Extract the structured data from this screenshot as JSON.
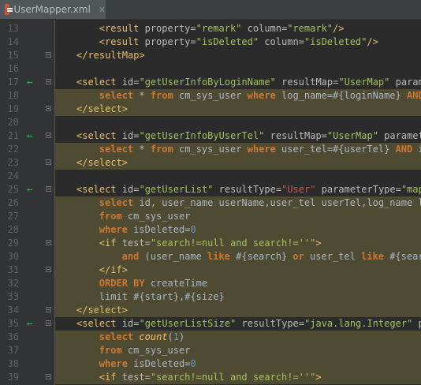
{
  "tab": {
    "filename": "UserMapper.xml",
    "close_glyph": "✕",
    "icon": "xml-file-icon"
  },
  "colors": {
    "background": "#2B2B2B",
    "gutter": "#313335",
    "highlight": "#4F4B32",
    "tag": "#E8BF6A",
    "string": "#A5C25C",
    "keyword": "#CC7832",
    "arrow": "#3DB05B"
  },
  "lines": [
    {
      "num": "13",
      "indent": 4,
      "hl": false,
      "mark": false,
      "fold": false,
      "segs": [
        [
          "tag",
          "<result "
        ],
        [
          "attr",
          "property="
        ],
        [
          "val",
          "\"remark\""
        ],
        [
          "attr",
          " column="
        ],
        [
          "val",
          "\"remark\""
        ],
        [
          "tag",
          "/>"
        ]
      ]
    },
    {
      "num": "14",
      "indent": 4,
      "hl": false,
      "mark": false,
      "fold": false,
      "segs": [
        [
          "tag",
          "<result "
        ],
        [
          "attr",
          "property="
        ],
        [
          "val",
          "\"isDeleted\""
        ],
        [
          "attr",
          " column="
        ],
        [
          "val",
          "\"isDeleted\""
        ],
        [
          "tag",
          "/>"
        ]
      ]
    },
    {
      "num": "15",
      "indent": 0,
      "hl": false,
      "mark": false,
      "fold": true,
      "segs": [
        [
          "tag",
          "</resultMap>"
        ]
      ]
    },
    {
      "num": "16",
      "indent": 0,
      "hl": false,
      "mark": false,
      "fold": false,
      "segs": []
    },
    {
      "num": "17",
      "indent": 0,
      "hl": false,
      "mark": true,
      "fold": true,
      "segs": [
        [
          "tag",
          "<select "
        ],
        [
          "attr",
          "id="
        ],
        [
          "val",
          "\"getUserInfoByLoginName\""
        ],
        [
          "attr",
          " resultMap="
        ],
        [
          "val",
          "\"UserMap\""
        ],
        [
          "attr",
          " paramet"
        ]
      ]
    },
    {
      "num": "18",
      "indent": 4,
      "hl": true,
      "mark": false,
      "fold": false,
      "segs": [
        [
          "kw",
          "select"
        ],
        [
          "txt",
          " * "
        ],
        [
          "kw",
          "from"
        ],
        [
          "txt",
          " cm_sys_user "
        ],
        [
          "kw",
          "where"
        ],
        [
          "txt",
          " log_name=#{loginName} "
        ],
        [
          "kw",
          "AND"
        ],
        [
          "txt",
          " i"
        ]
      ]
    },
    {
      "num": "19",
      "indent": 0,
      "hl": true,
      "mark": false,
      "fold": true,
      "segs": [
        [
          "tag",
          "</select>"
        ]
      ]
    },
    {
      "num": "20",
      "indent": 0,
      "hl": false,
      "mark": false,
      "fold": false,
      "segs": []
    },
    {
      "num": "21",
      "indent": 0,
      "hl": false,
      "mark": true,
      "fold": true,
      "segs": [
        [
          "tag",
          "<select "
        ],
        [
          "attr",
          "id="
        ],
        [
          "val",
          "\"getUserInfoByUserTel\""
        ],
        [
          "attr",
          " resultMap="
        ],
        [
          "val",
          "\"UserMap\""
        ],
        [
          "attr",
          " parameter"
        ]
      ]
    },
    {
      "num": "22",
      "indent": 4,
      "hl": true,
      "mark": false,
      "fold": false,
      "segs": [
        [
          "kw",
          "select"
        ],
        [
          "txt",
          " * "
        ],
        [
          "kw",
          "from"
        ],
        [
          "txt",
          " cm_sys_user "
        ],
        [
          "kw",
          "where"
        ],
        [
          "txt",
          " user_tel=#{userTel} "
        ],
        [
          "kw",
          "AND"
        ],
        [
          "txt",
          " isD"
        ]
      ]
    },
    {
      "num": "23",
      "indent": 0,
      "hl": true,
      "mark": false,
      "fold": true,
      "segs": [
        [
          "tag",
          "</select>"
        ]
      ]
    },
    {
      "num": "24",
      "indent": 0,
      "hl": false,
      "mark": false,
      "fold": false,
      "segs": []
    },
    {
      "num": "25",
      "indent": 0,
      "hl": false,
      "mark": true,
      "fold": true,
      "segs": [
        [
          "tag",
          "<select "
        ],
        [
          "attr",
          "id="
        ],
        [
          "val",
          "\"getUserList\""
        ],
        [
          "attr",
          " resultType="
        ],
        [
          "valr",
          "\"User\""
        ],
        [
          "attr",
          " parameterType="
        ],
        [
          "val",
          "\"map\""
        ],
        [
          "tag",
          ">"
        ]
      ]
    },
    {
      "num": "26",
      "indent": 4,
      "hl": true,
      "mark": false,
      "fold": false,
      "segs": [
        [
          "kw",
          "select"
        ],
        [
          "txt",
          " id, user_name userName,user_tel userTel,log_name log"
        ]
      ]
    },
    {
      "num": "27",
      "indent": 4,
      "hl": true,
      "mark": false,
      "fold": false,
      "segs": [
        [
          "kw",
          "from"
        ],
        [
          "txt",
          " cm_sys_user"
        ]
      ]
    },
    {
      "num": "28",
      "indent": 4,
      "hl": true,
      "mark": false,
      "fold": false,
      "segs": [
        [
          "kw",
          "where"
        ],
        [
          "txt",
          " isDeleted="
        ],
        [
          "num",
          "0"
        ]
      ]
    },
    {
      "num": "29",
      "indent": 4,
      "hl": true,
      "mark": false,
      "fold": true,
      "segs": [
        [
          "tag",
          "<if "
        ],
        [
          "attr",
          "test="
        ],
        [
          "val",
          "\"search!=null and search!=''\""
        ],
        [
          "tag",
          ">"
        ]
      ]
    },
    {
      "num": "30",
      "indent": 8,
      "hl": true,
      "mark": false,
      "fold": false,
      "segs": [
        [
          "kw",
          "and"
        ],
        [
          "txt",
          " (user_name "
        ],
        [
          "kw",
          "like"
        ],
        [
          "txt",
          " #{search} "
        ],
        [
          "kw",
          "or"
        ],
        [
          "txt",
          " user_tel "
        ],
        [
          "kw",
          "like"
        ],
        [
          "txt",
          " #{search"
        ]
      ]
    },
    {
      "num": "31",
      "indent": 4,
      "hl": true,
      "mark": false,
      "fold": true,
      "segs": [
        [
          "tag",
          "</if>"
        ]
      ]
    },
    {
      "num": "32",
      "indent": 4,
      "hl": true,
      "mark": false,
      "fold": false,
      "segs": [
        [
          "kw",
          "ORDER BY"
        ],
        [
          "txt",
          " createTime"
        ]
      ]
    },
    {
      "num": "33",
      "indent": 4,
      "hl": true,
      "mark": false,
      "fold": false,
      "segs": [
        [
          "txt",
          "limit #{start},#{size}"
        ]
      ]
    },
    {
      "num": "34",
      "indent": 0,
      "hl": true,
      "mark": false,
      "fold": true,
      "segs": [
        [
          "tag",
          "</select>"
        ]
      ]
    },
    {
      "num": "35",
      "indent": 0,
      "hl": false,
      "mark": true,
      "fold": true,
      "segs": [
        [
          "tag",
          "<select "
        ],
        [
          "attr",
          "id="
        ],
        [
          "val",
          "\"getUserListSize\""
        ],
        [
          "attr",
          " resultType="
        ],
        [
          "val",
          "\"java.lang.Integer\""
        ],
        [
          "attr",
          " par"
        ]
      ]
    },
    {
      "num": "36",
      "indent": 4,
      "hl": true,
      "mark": false,
      "fold": false,
      "segs": [
        [
          "kw",
          "select"
        ],
        [
          "txt",
          " "
        ],
        [
          "fn",
          "count"
        ],
        [
          "txt",
          "("
        ],
        [
          "num",
          "1"
        ],
        [
          "txt",
          ")"
        ]
      ]
    },
    {
      "num": "37",
      "indent": 4,
      "hl": true,
      "mark": false,
      "fold": false,
      "segs": [
        [
          "kw",
          "from"
        ],
        [
          "txt",
          " cm_sys_user"
        ]
      ]
    },
    {
      "num": "38",
      "indent": 4,
      "hl": true,
      "mark": false,
      "fold": false,
      "segs": [
        [
          "kw",
          "where"
        ],
        [
          "txt",
          " isDeleted="
        ],
        [
          "num",
          "0"
        ]
      ]
    },
    {
      "num": "39",
      "indent": 4,
      "hl": true,
      "mark": false,
      "fold": true,
      "segs": [
        [
          "tag",
          "<if "
        ],
        [
          "attr",
          "test="
        ],
        [
          "val",
          "\"search!=null and search!=''\""
        ],
        [
          "tag",
          ">"
        ]
      ]
    }
  ]
}
